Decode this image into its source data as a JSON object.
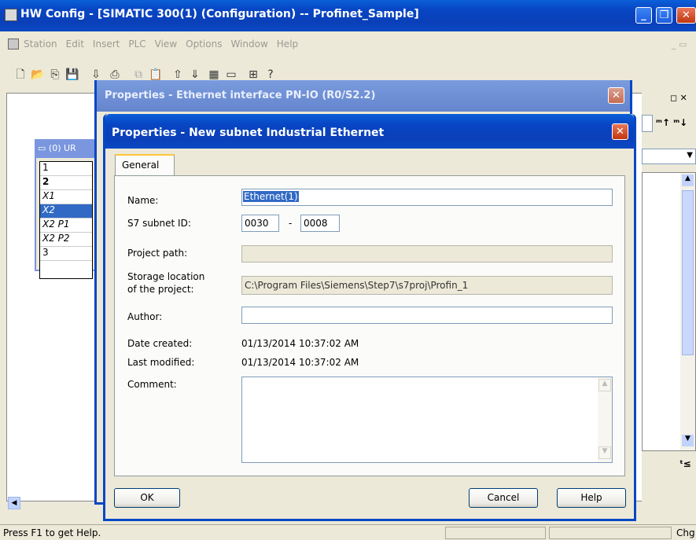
{
  "app": {
    "title": "HW Config - [SIMATIC 300(1) (Configuration) -- Profinet_Sample]",
    "menu": [
      "Station",
      "Edit",
      "Insert",
      "PLC",
      "View",
      "Options",
      "Window",
      "Help"
    ],
    "status_text": "Press F1 to get Help.",
    "status_right": "Chg",
    "rack_title": "(0) UR",
    "rack_slots": [
      "1",
      "2",
      "X1",
      "X2",
      "X2 P1",
      "X2 P2",
      "3"
    ]
  },
  "outer_dialog": {
    "title": "Properties - Ethernet interface  PN-IO (R0/S2.2)"
  },
  "dialog": {
    "title": "Properties - New subnet Industrial Ethernet",
    "tab": "General",
    "name_label": "Name:",
    "name_value": "Ethernet(1)",
    "subnet_label": "S7 subnet ID:",
    "subnet_id_1": "0030",
    "subnet_sep": "-",
    "subnet_id_2": "0008",
    "project_path_label": "Project path:",
    "project_path_value": "",
    "storage_label_1": "Storage location",
    "storage_label_2": "of the project:",
    "storage_value": "C:\\Program Files\\Siemens\\Step7\\s7proj\\Profin_1",
    "author_label": "Author:",
    "author_value": "",
    "date_created_label": "Date created:",
    "date_created_value": "01/13/2014 10:37:02 AM",
    "last_modified_label": "Last modified:",
    "last_modified_value": "01/13/2014 10:37:02 AM",
    "comment_label": "Comment:",
    "comment_value": "",
    "ok_label": "OK",
    "cancel_label": "Cancel",
    "help_label": "Help"
  }
}
